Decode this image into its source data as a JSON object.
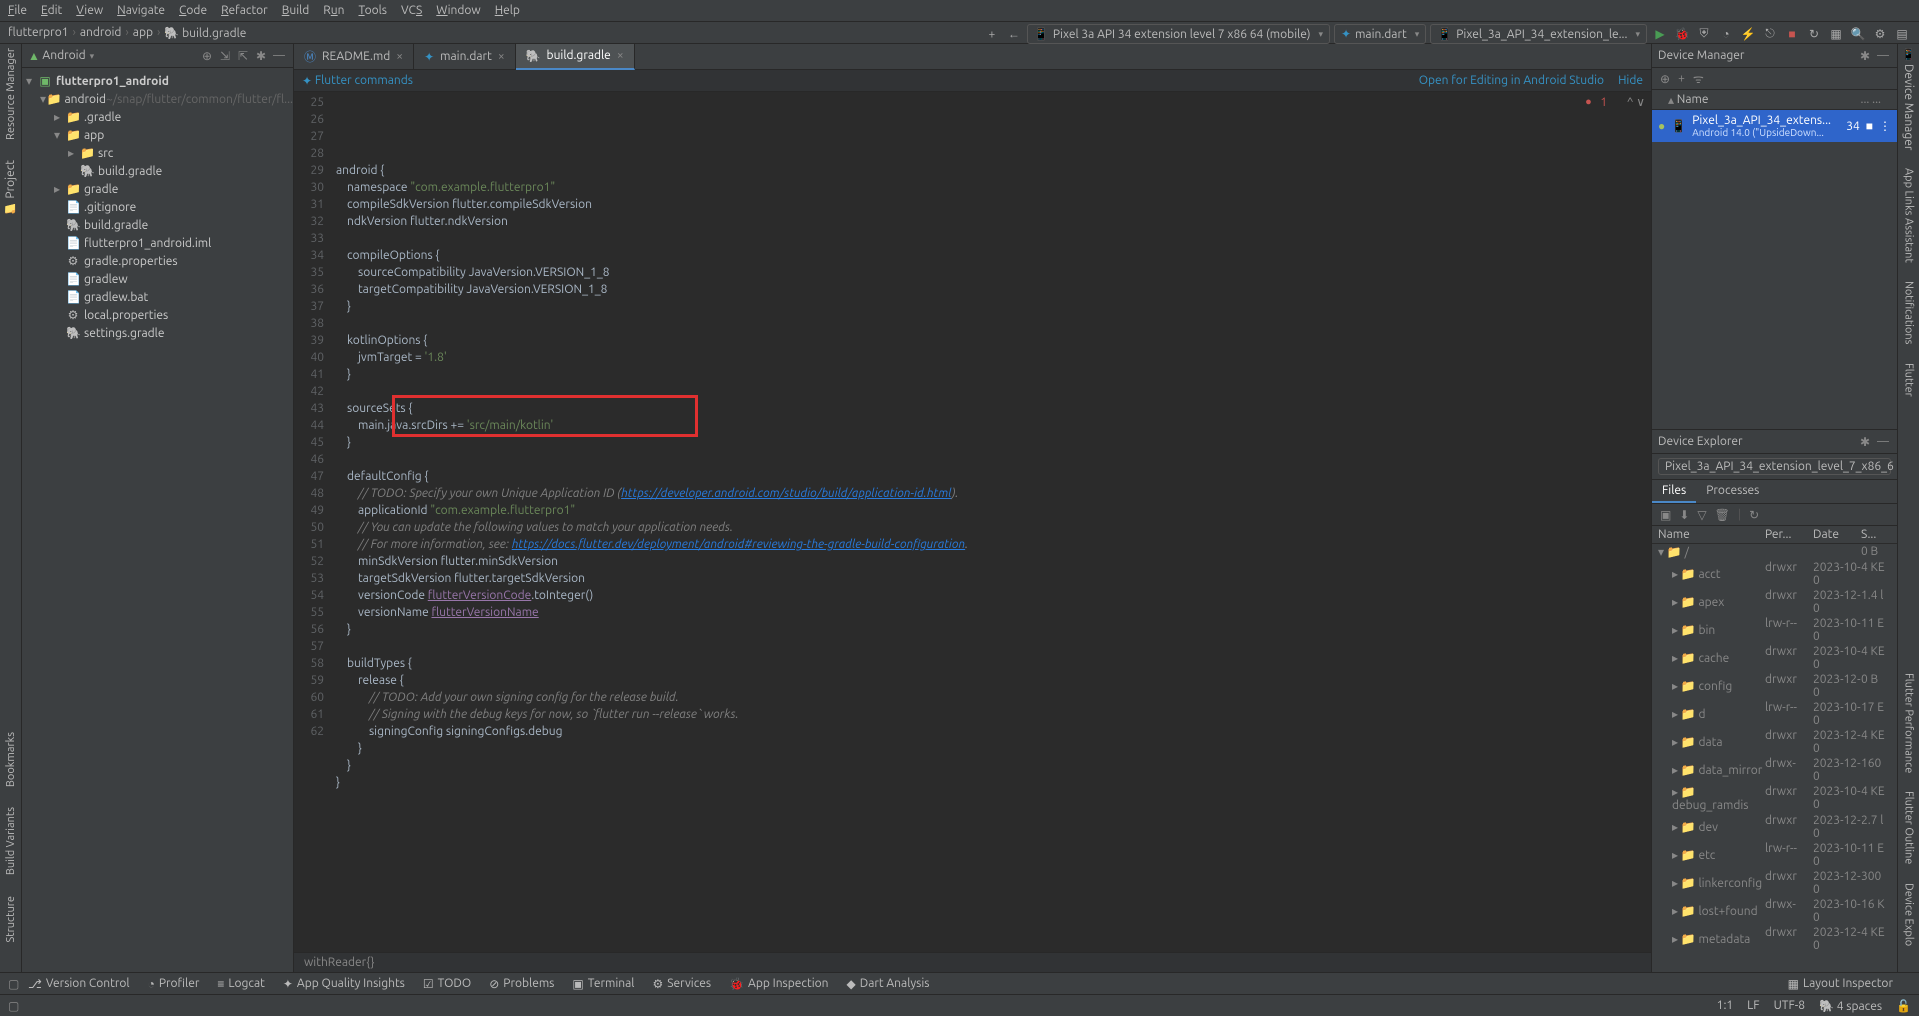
{
  "menu": [
    "File",
    "Edit",
    "View",
    "Navigate",
    "Code",
    "Refactor",
    "Build",
    "Run",
    "Tools",
    "VCS",
    "Window",
    "Help"
  ],
  "breadcrumb": [
    "flutterpro1",
    "android",
    "app",
    "build.gradle"
  ],
  "toolbar": {
    "device": "Pixel 3a API 34 extension level 7 x86 64 (mobile)",
    "entry": "main.dart",
    "runcfg": "Pixel_3a_API_34_extension_le..."
  },
  "project": {
    "header": "Android",
    "root": "flutterpro1_android",
    "android_path": "~/snap/flutter/common/flutter/fl...",
    "nodes": [
      ".gradle",
      "app",
      "src",
      "build.gradle",
      "gradle",
      ".gitignore",
      "build.gradle",
      "flutterpro1_android.iml",
      "gradle.properties",
      "gradlew",
      "gradlew.bat",
      "local.properties",
      "settings.gradle"
    ]
  },
  "tabs": [
    {
      "name": "README.md"
    },
    {
      "name": "main.dart"
    },
    {
      "name": "build.gradle",
      "active": true
    }
  ],
  "cmdbar": {
    "left": "Flutter commands",
    "open": "Open for Editing in Android Studio",
    "hide": "Hide"
  },
  "error_badge": "1",
  "code": {
    "start": 25,
    "lines": [
      {
        "t": "android {",
        "kw": false
      },
      {
        "t": "    namespace ",
        "s": "\"com.example.flutterpro1\""
      },
      {
        "t": "    compileSdkVersion flutter.compileSdkVersion"
      },
      {
        "t": "    ndkVersion flutter.ndkVersion"
      },
      {
        "t": ""
      },
      {
        "t": "    compileOptions {"
      },
      {
        "t": "        sourceCompatibility JavaVersion.VERSION_1_8"
      },
      {
        "t": "        targetCompatibility JavaVersion.VERSION_1_8"
      },
      {
        "t": "    }"
      },
      {
        "t": ""
      },
      {
        "t": "    kotlinOptions {"
      },
      {
        "t": "        jvmTarget = ",
        "s": "'1.8'"
      },
      {
        "t": "    }"
      },
      {
        "t": ""
      },
      {
        "t": "    sourceSets {"
      },
      {
        "t": "        main.java.srcDirs += ",
        "s": "'src/main/kotlin'"
      },
      {
        "t": "    }"
      },
      {
        "t": ""
      },
      {
        "t": "    defaultConfig {"
      },
      {
        "c": "        // TODO: Specify your own Unique Application ID (",
        "l": "https://developer.android.com/studio/build/application-id.html",
        "ce": ")."
      },
      {
        "t": "        applicationId ",
        "s": "\"com.example.flutterpro1\""
      },
      {
        "c": "        // You can update the following values to match your application needs."
      },
      {
        "c": "        // For more information, see: ",
        "l": "https://docs.flutter.dev/deployment/android#reviewing-the-gradle-build-configuration",
        "ce": "."
      },
      {
        "t": "        minSdkVersion flutter.minSdkVersion"
      },
      {
        "t": "        targetSdkVersion flutter.targetSdkVersion"
      },
      {
        "t": "        versionCode ",
        "id": "flutterVersionCode",
        "t2": ".toInteger()"
      },
      {
        "t": "        versionName ",
        "id": "flutterVersionName"
      },
      {
        "t": "    }"
      },
      {
        "t": ""
      },
      {
        "t": "    buildTypes {"
      },
      {
        "t": "        release {"
      },
      {
        "c": "            // TODO: Add your own signing config for the release build."
      },
      {
        "c": "            // Signing with the debug keys for now, so `flutter run --release` works."
      },
      {
        "t": "            signingConfig signingConfigs.debug"
      },
      {
        "t": "        }"
      },
      {
        "t": "    }"
      },
      {
        "t": "}"
      },
      {
        "t": ""
      }
    ]
  },
  "footer_cmd": "withReader{}",
  "dm": {
    "title": "Device Manager",
    "col_name": "Name",
    "menu": "...   ...",
    "device_name": "Pixel_3a_API_34_extens...",
    "device_sub": "Android 14.0 (\"UpsideDown...",
    "device_api": "34"
  },
  "de": {
    "title": "Device Explorer",
    "selector": "Pixel_3a_API_34_extension_level_7_x86_6",
    "tabs": [
      "Files",
      "Processes"
    ],
    "cols": [
      "Name",
      "Per...",
      "Date",
      "S..."
    ],
    "rows": [
      {
        "n": "/",
        "p": "",
        "d": "",
        "s": "0 B",
        "root": true
      },
      {
        "n": "acct",
        "p": "drwxr",
        "d": "2023-10-0",
        "s": "4 KE"
      },
      {
        "n": "apex",
        "p": "drwxr",
        "d": "2023-12-0",
        "s": "1.4 l"
      },
      {
        "n": "bin",
        "p": "lrw-r--",
        "d": "2023-10-0",
        "s": "11 E"
      },
      {
        "n": "cache",
        "p": "drwxr",
        "d": "2023-10-0",
        "s": "4 KE"
      },
      {
        "n": "config",
        "p": "drwxr",
        "d": "2023-12-0",
        "s": "0 B"
      },
      {
        "n": "d",
        "p": "lrw-r--",
        "d": "2023-10-0",
        "s": "17 E"
      },
      {
        "n": "data",
        "p": "drwxr",
        "d": "2023-12-0",
        "s": "4 KE"
      },
      {
        "n": "data_mirror",
        "p": "drwx-",
        "d": "2023-12-0",
        "s": "160"
      },
      {
        "n": "debug_ramdis",
        "p": "drwxr",
        "d": "2023-10-0",
        "s": "4 KE"
      },
      {
        "n": "dev",
        "p": "drwxr",
        "d": "2023-12-0",
        "s": "2.7 l"
      },
      {
        "n": "etc",
        "p": "lrw-r--",
        "d": "2023-10-0",
        "s": "11 E"
      },
      {
        "n": "linkerconfig",
        "p": "drwxr",
        "d": "2023-12-0",
        "s": "300"
      },
      {
        "n": "lost+found",
        "p": "drwx-",
        "d": "2023-10-0",
        "s": "16 K"
      },
      {
        "n": "metadata",
        "p": "drwxr",
        "d": "2023-12-0",
        "s": "4 KE"
      }
    ]
  },
  "bottom_tools": [
    "Version Control",
    "Profiler",
    "Logcat",
    "App Quality Insights",
    "TODO",
    "Problems",
    "Terminal",
    "Services",
    "App Inspection",
    "Dart Analysis"
  ],
  "status": {
    "layout": "Layout Inspector",
    "pos": "1:1",
    "lf": "LF",
    "enc": "UTF-8",
    "sp": "4 spaces"
  },
  "right_tools": [
    "Device Manager",
    "App Links Assistant",
    "Notifications",
    "Flutter",
    "Flutter Performance",
    "Flutter Outline",
    "Device Explo"
  ],
  "left_tools": [
    "Resource Manager",
    "Project",
    "Bookmarks",
    "Build Variants",
    "Structure"
  ]
}
